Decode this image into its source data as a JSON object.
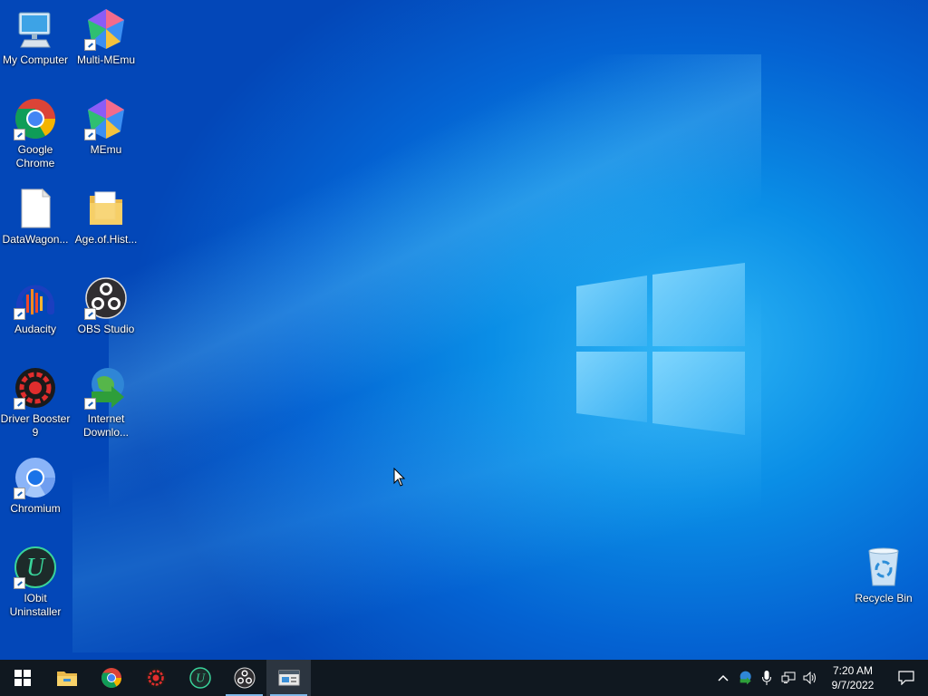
{
  "desktop": {
    "icons": [
      {
        "label": "My Computer",
        "icon": "computer-icon"
      },
      {
        "label": "Multi-MEmu",
        "icon": "multi-memu-icon"
      },
      {
        "label": "Google Chrome",
        "icon": "chrome-icon"
      },
      {
        "label": "MEmu",
        "icon": "memu-icon"
      },
      {
        "label": "DataWagon...",
        "icon": "file-icon"
      },
      {
        "label": "Age.of.Hist...",
        "icon": "folder-icon"
      },
      {
        "label": "Audacity",
        "icon": "audacity-icon"
      },
      {
        "label": "OBS Studio",
        "icon": "obs-icon"
      },
      {
        "label": "Driver Booster 9",
        "icon": "driver-booster-icon"
      },
      {
        "label": "Internet Downlo...",
        "icon": "internet-download-manager-icon"
      },
      {
        "label": "Chromium",
        "icon": "chromium-icon"
      },
      {
        "label": "IObit Uninstaller",
        "icon": "iobit-uninstaller-icon"
      },
      {
        "label": "Recycle Bin",
        "icon": "recycle-bin-icon"
      }
    ]
  },
  "taskbar": {
    "apps": [
      {
        "name": "Start",
        "icon": "windows-start-icon"
      },
      {
        "name": "File Explorer",
        "icon": "file-explorer-icon"
      },
      {
        "name": "Google Chrome",
        "icon": "chrome-icon"
      },
      {
        "name": "Driver Booster",
        "icon": "driver-booster-icon"
      },
      {
        "name": "IObit Uninstaller",
        "icon": "iobit-uninstaller-icon"
      },
      {
        "name": "OBS Studio",
        "icon": "obs-icon"
      },
      {
        "name": "Active window",
        "icon": "window-app-icon"
      }
    ],
    "tray": {
      "time": "7:20 AM",
      "date": "9/7/2022"
    }
  },
  "colors": {
    "wallpaper": "#0a8ee6",
    "taskbar": "#101820",
    "accent": "#7fb7e8"
  }
}
